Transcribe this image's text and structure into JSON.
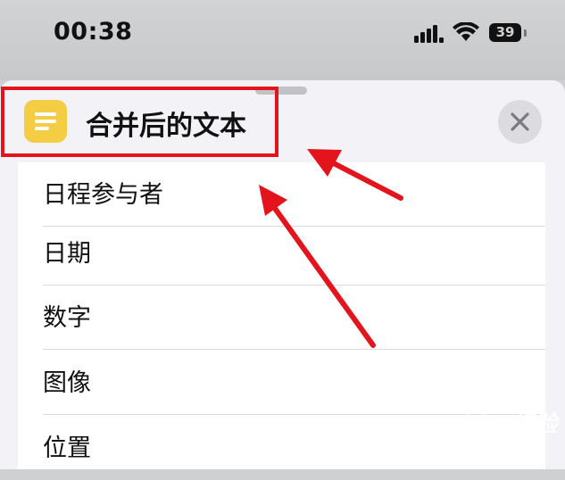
{
  "status_bar": {
    "time": "00:38",
    "battery": "39"
  },
  "sheet": {
    "title": "合并后的文本",
    "app_icon": "text-lines-icon",
    "close_icon": "close-icon"
  },
  "list": {
    "items": [
      {
        "label": "日程参与者"
      },
      {
        "label": "日期"
      },
      {
        "label": "数字"
      },
      {
        "label": "图像"
      },
      {
        "label": "位置"
      }
    ]
  },
  "annotations": {
    "highlight_color": "#e3141c",
    "arrow_color": "#e3141c"
  },
  "watermark": "Baidu 经验"
}
